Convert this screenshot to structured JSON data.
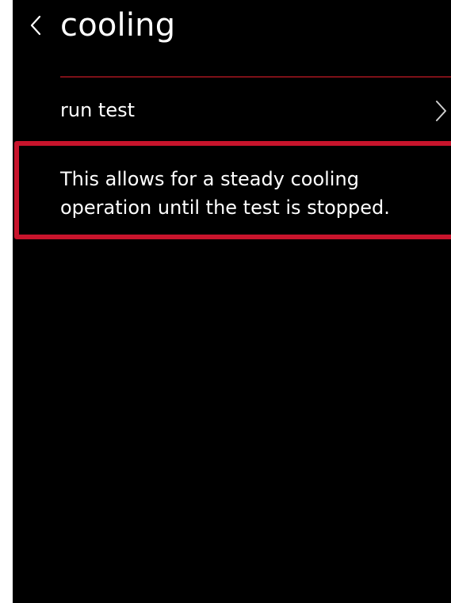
{
  "header": {
    "title": "cooling",
    "back_icon": "chevron-left-icon"
  },
  "menu": {
    "items": [
      {
        "label": "run test",
        "icon": "chevron-right-icon"
      }
    ]
  },
  "info": {
    "text": "This allows for a steady cooling operation until the test is stopped."
  },
  "colors": {
    "background": "#000000",
    "text": "#ffffff",
    "divider": "#7d1018",
    "highlight_border": "#c8142c"
  }
}
